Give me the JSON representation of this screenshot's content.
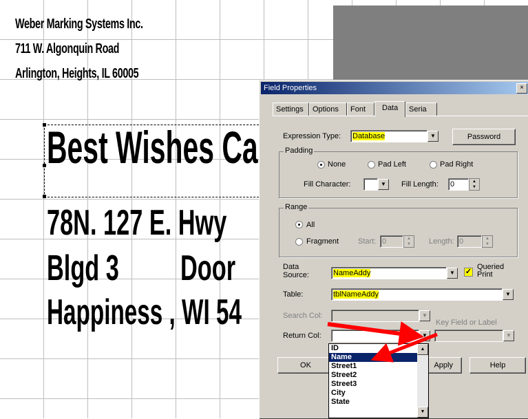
{
  "label_canvas": {
    "address_lines": [
      "Weber Marking Systems Inc.",
      "711 W. Algonquin Road",
      "Arlington, Heights, IL 60005"
    ],
    "big_lines": [
      "Best Wishes Card",
      "78N. 127 E. Hwy",
      "Blgd 3",
      "Door",
      "Happiness , WI 54"
    ]
  },
  "dialog": {
    "title": "Field Properties",
    "close_glyph": "×",
    "tabs": [
      "Settings",
      "Options",
      "Font",
      "Data",
      "Seria"
    ],
    "active_tab": "Data",
    "expression_type": {
      "label": "Expression Type:",
      "value": "Database"
    },
    "password_button": "Password",
    "padding": {
      "title": "Padding",
      "options": [
        "None",
        "Pad Left",
        "Pad Right"
      ],
      "selected": "None",
      "fill_character_label": "Fill Character:",
      "fill_length_label": "Fill Length:",
      "fill_length_value": "0"
    },
    "range": {
      "title": "Range",
      "options": [
        "All",
        "Fragment"
      ],
      "selected": "All",
      "start_label": "Start:",
      "start_value": "0",
      "length_label": "Length:",
      "length_value": "0"
    },
    "data_source": {
      "label_line1": "Data",
      "label_line2": "Source:",
      "value": "NameAddy"
    },
    "queried_print": {
      "label_line1": "Queried",
      "label_line2": "Print",
      "checked": true
    },
    "table": {
      "label": "Table:",
      "value": "tblNameAddy"
    },
    "search_col": {
      "label": "Search Col:"
    },
    "key_field_label": "Key Field or Label",
    "return_col": {
      "label": "Return Col:"
    },
    "buttons": {
      "ok": "OK",
      "apply": "Apply",
      "help": "Help"
    }
  },
  "return_col_dropdown": {
    "items": [
      "ID",
      "Name",
      "Street1",
      "Street2",
      "Street3",
      "City",
      "State"
    ],
    "selected": "Name"
  },
  "colors": {
    "highlight": "#ffff00",
    "arrow": "#ff0000",
    "selection": "#0a246a"
  }
}
